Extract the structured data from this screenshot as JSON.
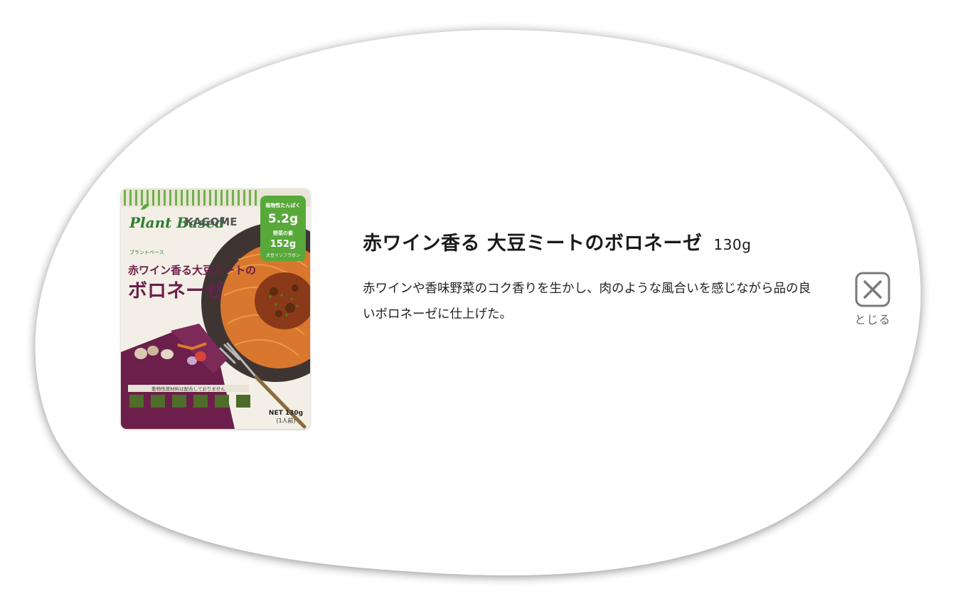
{
  "product": {
    "image_alt": "KAGOME Plant Based 赤ワイン香る大豆ミートのボロネーゼ package",
    "package": {
      "series_en": "Plant Based",
      "series_jp": "プラントベース",
      "brand": "KAGOME",
      "name_line1": "赤ワイン香る大豆ミートの",
      "name_line2": "ボロネーゼ",
      "badge_line1": "植物性たんぱく",
      "badge_value1": "5.2g",
      "badge_line2": "野菜の素",
      "badge_value2": "152g",
      "badge_line3": "大豆イソフラボン",
      "notice": "動物性原材料は配合しておりません",
      "net": "NET 130g",
      "servings": "(1人前)"
    },
    "title": "赤ワイン香る 大豆ミートのボロネーゼ",
    "weight": "130g",
    "description": "赤ワインや香味野菜のコク香りを生かし、肉のような風合いを感じながら品の良いボロネーゼに仕上げた。"
  },
  "close": {
    "label": "とじる",
    "icon": "close-icon"
  },
  "colors": {
    "modal_bg": "#ffffff",
    "close_gray": "#777777",
    "package_green": "#58a83a",
    "package_purple": "#6b1f4a"
  }
}
